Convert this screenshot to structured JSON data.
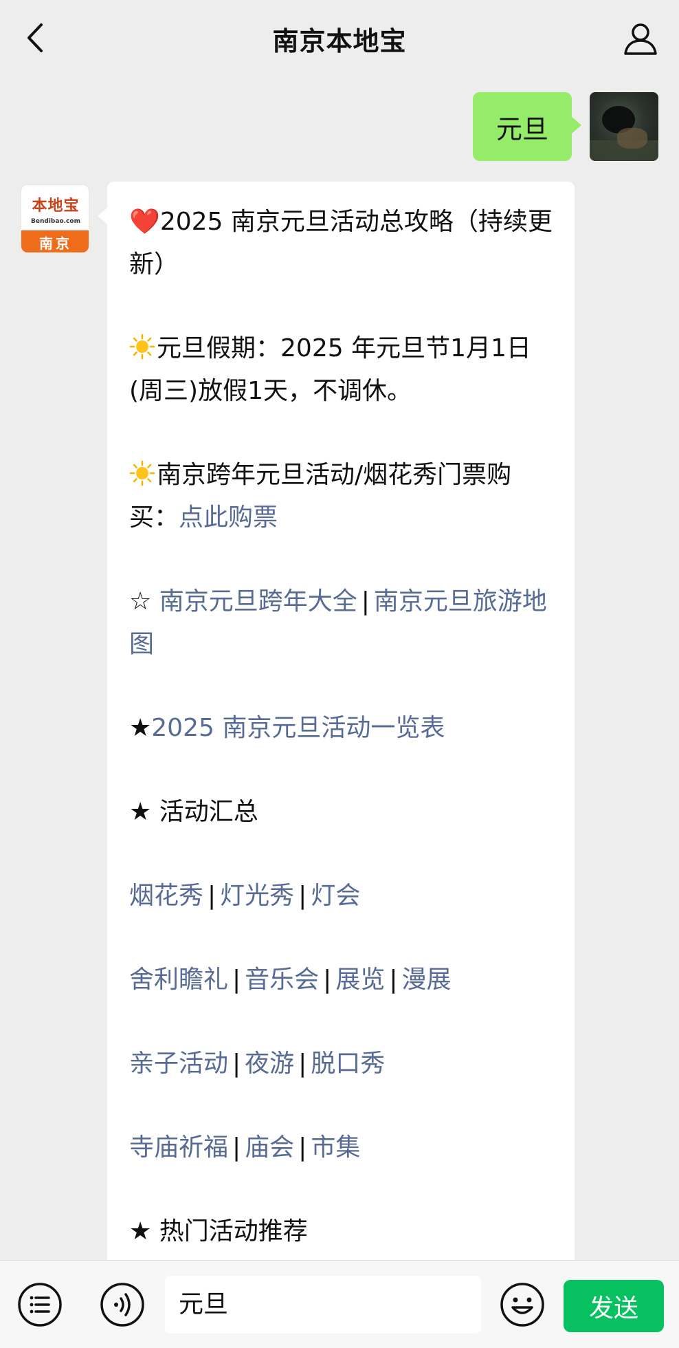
{
  "header": {
    "title": "南京本地宝"
  },
  "chat": {
    "my_message": "元旦",
    "bot_avatar": {
      "logo_cn": "本地宝",
      "logo_en": "Bendibao.com",
      "city": "南京"
    },
    "reply": {
      "heading_prefix": "❤️",
      "heading": "2025 南京元旦活动总攻略（持续更新）",
      "holiday_label": "元旦假期：",
      "holiday_text": "2025 年元旦节1月1日(周三)放假1天，不调休。",
      "tickets_label": "南京跨年元旦活动/烟花秀门票购买：",
      "tickets_link": "点此购票",
      "links_star": "☆",
      "link_crossyear": "南京元旦跨年大全",
      "link_sep": "|",
      "link_travelmap": "南京元旦旅游地图",
      "table_star": "★",
      "table_link": "2025 南京元旦活动一览表",
      "summary_title": "★ 活动汇总",
      "row1": [
        "烟花秀",
        "灯光秀",
        "灯会"
      ],
      "row2": [
        "舍利瞻礼",
        "音乐会",
        "展览",
        "漫展"
      ],
      "row3": [
        "亲子活动",
        "夜游",
        "脱口秀"
      ],
      "row4": [
        "寺庙祈福",
        "庙会",
        "市集"
      ],
      "hot_title": "★ 热门活动推荐"
    }
  },
  "footer": {
    "input_value": "元旦",
    "send_label": "发送"
  },
  "colors": {
    "link": "#576b95",
    "my_bubble": "#95ec69",
    "send_button": "#07c160",
    "background": "#ededed"
  }
}
